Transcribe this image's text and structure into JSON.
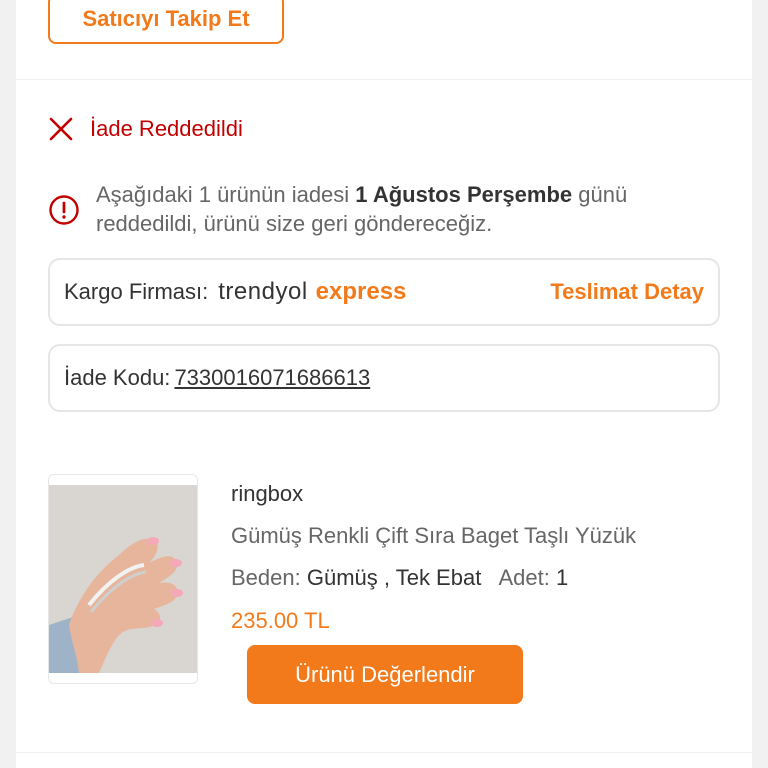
{
  "seller": {
    "follow_label": "Satıcıyı Takip Et"
  },
  "return_status": {
    "icon": "close-icon",
    "label": "İade Reddedildi",
    "color": "#c30000"
  },
  "info": {
    "icon": "info-icon",
    "text_before": "Aşağıdaki 1 ürünün iadesi ",
    "text_bold": "1 Ağustos Perşembe",
    "text_after": " günü reddedildi, ürünü size geri göndereceğiz."
  },
  "cargo": {
    "label": "Kargo Firması:",
    "logo_part1": "trendyol",
    "logo_part2": "express",
    "detail_link": "Teslimat Detay"
  },
  "return_code": {
    "label": "İade Kodu:",
    "value": "7330016071686613"
  },
  "product": {
    "brand": "ringbox",
    "name": "Gümüş Renkli Çift Sıra Baget Taşlı Yüzük",
    "size_label": "Beden:",
    "size_value": "Gümüş , Tek Ebat",
    "qty_label": "Adet:",
    "qty_value": "1",
    "price": "235.00 TL",
    "rate_button": "Ürünü Değerlendir"
  },
  "colors": {
    "accent": "#f27a1a",
    "danger": "#c30000"
  }
}
